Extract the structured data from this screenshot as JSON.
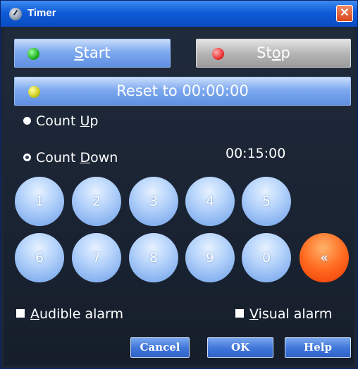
{
  "window": {
    "title": "Timer",
    "close_label": "✕"
  },
  "buttons": {
    "start": {
      "pre": "",
      "mnemonic": "S",
      "post": "tart"
    },
    "stop": {
      "pre": "St",
      "mnemonic": "o",
      "post": "p"
    },
    "reset": {
      "label": "Reset to 00:00:00"
    }
  },
  "mode": {
    "count_up": {
      "pre": "Count ",
      "mnemonic": "U",
      "post": "p",
      "selected": false
    },
    "count_down": {
      "pre": "Count ",
      "mnemonic": "D",
      "post": "own",
      "selected": true
    }
  },
  "time_display": "00:15:00",
  "keypad": {
    "row1": [
      "1",
      "2",
      "3",
      "4",
      "5"
    ],
    "row2": [
      "6",
      "7",
      "8",
      "9",
      "0"
    ],
    "backspace_label": "«"
  },
  "options": {
    "audible": {
      "pre": "",
      "mnemonic": "A",
      "post": "udible alarm",
      "checked": false
    },
    "visual": {
      "pre": "",
      "mnemonic": "V",
      "post": "isual alarm",
      "checked": false
    }
  },
  "dialog_buttons": {
    "cancel": "Cancel",
    "ok": "OK",
    "help": "Help"
  },
  "colors": {
    "title_bar": "#0e5bd8",
    "background": "#1c2636",
    "key_blue": "#8ab4f0",
    "key_orange": "#ff6a1f"
  }
}
